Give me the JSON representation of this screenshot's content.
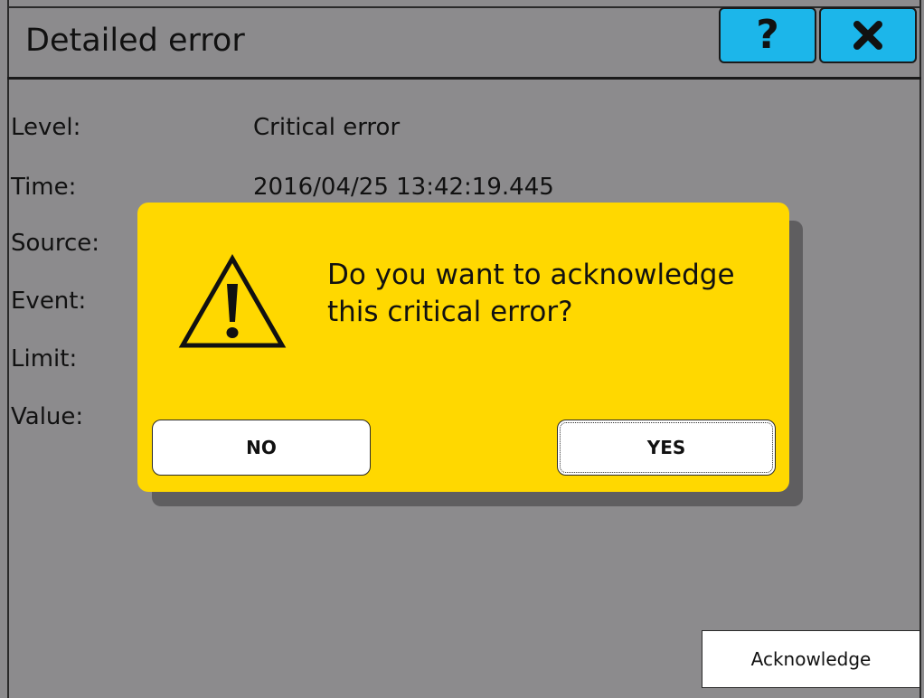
{
  "header": {
    "title": "Detailed error",
    "help_icon": "question-mark-icon",
    "close_icon": "close-x-icon",
    "button_color": "#1cb6ea"
  },
  "details": {
    "fields": [
      {
        "label": "Level:",
        "value": "Critical error"
      },
      {
        "label": "Time:",
        "value": "2016/04/25 13:42:19.445"
      },
      {
        "label": "Source:",
        "value": ""
      },
      {
        "label": "Event:",
        "value": ""
      },
      {
        "label": "Limit:",
        "value": ""
      },
      {
        "label": "Value:",
        "value": ""
      }
    ]
  },
  "dialog": {
    "icon": "warning-triangle-icon",
    "message": "Do you want to acknowledge this critical error?",
    "no_label": "NO",
    "yes_label": "YES",
    "background_color": "#ffd800"
  },
  "footer": {
    "acknowledge_label": "Acknowledge"
  }
}
